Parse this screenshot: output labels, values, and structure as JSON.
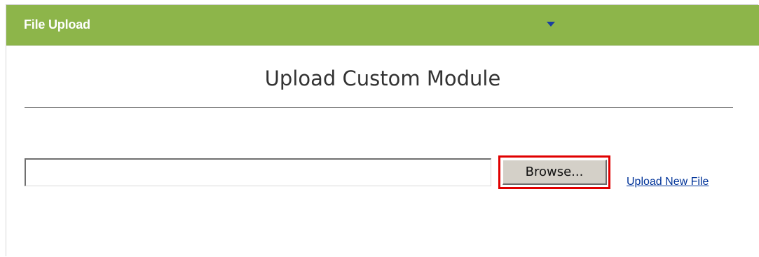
{
  "header": {
    "title": "File Upload",
    "dropdown_icon": "triangle-down",
    "background_color": "#8db54a"
  },
  "main": {
    "page_title": "Upload Custom Module",
    "file_input": {
      "value": "",
      "placeholder": ""
    },
    "browse_button_label": "Browse...",
    "highlight_color": "#e00000",
    "upload_link_label": "Upload New File",
    "link_color": "#003399"
  }
}
